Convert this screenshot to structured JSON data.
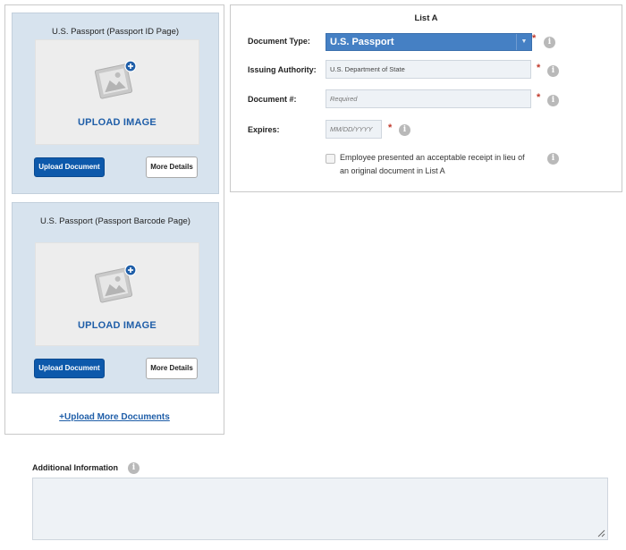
{
  "documents": [
    {
      "title": "U.S. Passport (Passport ID Page)",
      "upload_label": "UPLOAD IMAGE",
      "upload_button": "Upload Document",
      "details_button": "More Details"
    },
    {
      "title": "U.S. Passport (Passport Barcode Page)",
      "upload_label": "UPLOAD IMAGE",
      "upload_button": "Upload Document",
      "details_button": "More Details"
    }
  ],
  "upload_more_link": "+Upload More Documents",
  "form": {
    "title": "List A",
    "document_type": {
      "label": "Document Type:",
      "value": "U.S. Passport"
    },
    "issuing_authority": {
      "label": "Issuing Authority:",
      "value": "U.S. Department of State"
    },
    "document_number": {
      "label": "Document #:",
      "placeholder": "Required"
    },
    "expires": {
      "label": "Expires:",
      "placeholder": "MM/DD/YYYY"
    },
    "receipt_checkbox": {
      "label": "Employee presented an acceptable receipt in lieu of an original document in List A",
      "checked": false
    },
    "required_mark": "*",
    "info_glyph": "i"
  },
  "additional_info": {
    "label": "Additional Information",
    "value": ""
  },
  "icons": {
    "upload": "image-upload-icon",
    "info": "info-icon",
    "dropdown": "chevron-down-icon",
    "resize": "resize-handle-icon"
  },
  "colors": {
    "accent": "#0d59ab",
    "select_bg": "#4580c4",
    "card_bg": "#d7e3ee",
    "link": "#1f5ea8",
    "required": "#c0392b"
  }
}
